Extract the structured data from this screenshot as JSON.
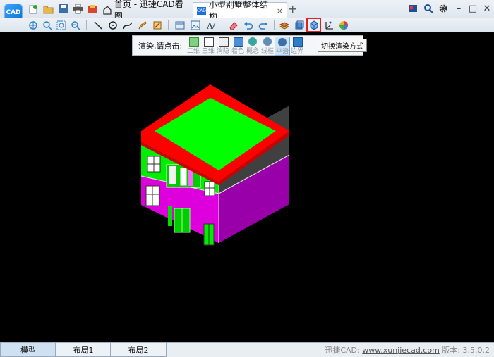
{
  "app": {
    "logo_text": "CAD"
  },
  "tabs": [
    {
      "label": "首页 - 迅捷CAD看图"
    },
    {
      "label": "小型别墅整体结构..."
    }
  ],
  "tab_close": "×",
  "tab_add": "+",
  "window": {
    "minimize": "–",
    "maximize": "□",
    "close": "✕"
  },
  "render": {
    "label": "渲染,请点击:",
    "options": [
      "二维",
      "三维",
      "消隐",
      "着色",
      "概念",
      "线框",
      "平滑",
      "边界"
    ],
    "active": "平滑"
  },
  "tooltip": "切换渲染方式",
  "layout_tabs": [
    "模型",
    "布局1",
    "布局2"
  ],
  "active_layout": "模型",
  "status": {
    "prefix": "迅捷CAD: ",
    "url": "www.xunjiecad.com",
    "version": " 版本: 3.5.0.2"
  },
  "colors": {
    "roof": "#ff0000",
    "roof_top": "#00ff00",
    "upper_front": "#00ee00",
    "upper_side": "#404040",
    "lower_front": "#dd00dd",
    "lower_side": "#9900aa",
    "tool_highlight": "#e02020"
  }
}
